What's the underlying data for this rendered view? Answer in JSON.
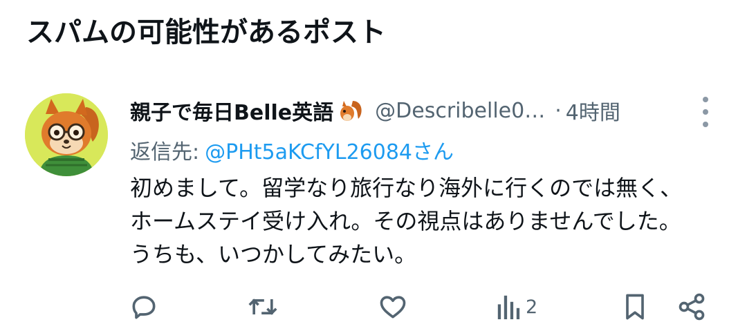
{
  "section": {
    "title": "スパムの可能性があるポスト"
  },
  "post": {
    "display_name": "親子で毎日Belle英語",
    "name_emoji": "squirrel-emoji",
    "handle": "@Describelle0…",
    "separator": "·",
    "timestamp": "4時間",
    "reply_to_label": "返信先:",
    "reply_to_handle": "@PHt5aKCfYL26084さん",
    "body_lines": [
      "初めまして。留学なり旅行なり海外に行くのでは無く、",
      "ホームステイ受け入れ。その視点はありませんでした。",
      "うちも、いつかしてみたい。"
    ],
    "actions": {
      "reply_icon": "reply-icon",
      "repost_icon": "repost-icon",
      "like_icon": "heart-icon",
      "views_icon": "views-icon",
      "views_count": "2",
      "bookmark_icon": "bookmark-icon",
      "share_icon": "share-icon"
    }
  },
  "colors": {
    "text_primary": "#0f1419",
    "text_secondary": "#536471",
    "link": "#1d9bf0",
    "avatar_bg": "#d8e85a"
  }
}
